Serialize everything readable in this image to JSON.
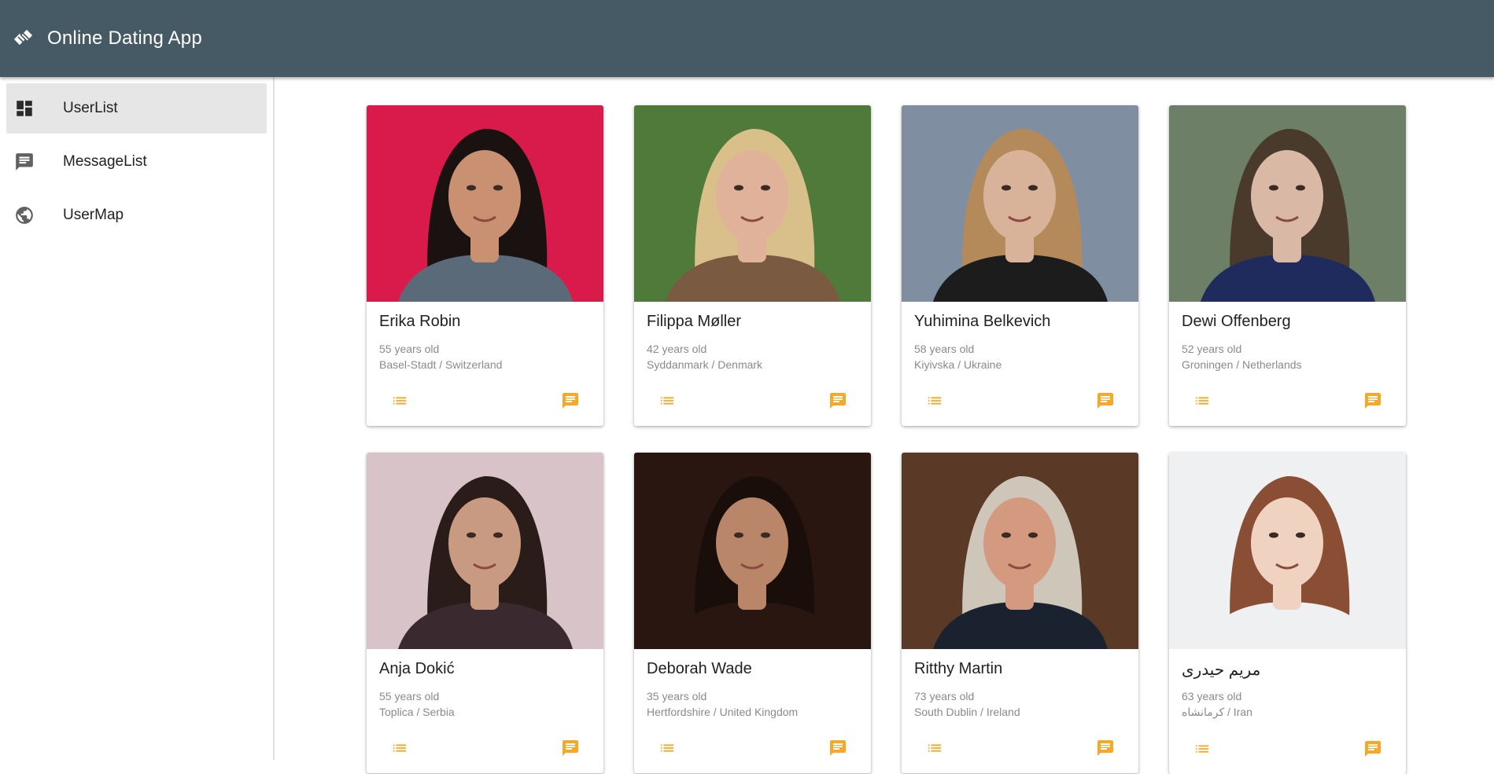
{
  "app": {
    "title": "Online Dating App",
    "logo_icon": "handshake-icon",
    "header_color": "#455a64"
  },
  "sidebar": {
    "items": [
      {
        "label": "UserList",
        "icon": "dashboard-icon",
        "active": true
      },
      {
        "label": "MessageList",
        "icon": "message-icon",
        "active": false
      },
      {
        "label": "UserMap",
        "icon": "globe-icon",
        "active": false
      }
    ]
  },
  "accent_color": "#f9a825",
  "users": [
    {
      "name": "Erika Robin",
      "age": "55 years old",
      "location": "Basel-Stadt / Switzerland",
      "photo_bg": "#d81b4a",
      "hair": "#1a1210",
      "skin": "#c99072",
      "shirt": "#5b6a78"
    },
    {
      "name": "Filippa Møller",
      "age": "42 years old",
      "location": "Syddanmark / Denmark",
      "photo_bg": "#4f7a3a",
      "hair": "#d9c08a",
      "skin": "#e0b29a",
      "shirt": "#7a5a40"
    },
    {
      "name": "Yuhimina Belkevich",
      "age": "58 years old",
      "location": "Kiyivska / Ukraine",
      "photo_bg": "#7f8ea0",
      "hair": "#b48a5a",
      "skin": "#d8b299",
      "shirt": "#1c1c1c"
    },
    {
      "name": "Dewi Offenberg",
      "age": "52 years old",
      "location": "Groningen / Netherlands",
      "photo_bg": "#6d7f66",
      "hair": "#4a3a2c",
      "skin": "#d9b9a6",
      "shirt": "#1f2b5c"
    },
    {
      "name": "Anja Dokić",
      "age": "55 years old",
      "location": "Toplica / Serbia",
      "photo_bg": "#d8c4c8",
      "hair": "#2a1c18",
      "skin": "#c99a82",
      "shirt": "#3a2a30"
    },
    {
      "name": "Deborah Wade",
      "age": "35 years old",
      "location": "Hertfordshire / United Kingdom",
      "photo_bg": "#2a1610",
      "hair": "#1a0e0a",
      "skin": "#b9866a",
      "shirt": "#2a1610"
    },
    {
      "name": "Ritthy Martin",
      "age": "73 years old",
      "location": "South Dublin / Ireland",
      "photo_bg": "#5a3a26",
      "hair": "#cfc6ba",
      "skin": "#d39a80",
      "shirt": "#1a2230"
    },
    {
      "name": "مریم حیدری",
      "age": "63 years old",
      "location": "کرمانشاه / Iran",
      "photo_bg": "#eef0f2",
      "hair": "#8a4e34",
      "skin": "#f0d2c0",
      "shirt": "#eef0f2"
    }
  ],
  "card_actions": {
    "details_icon": "list-icon",
    "message_icon": "chat-icon"
  }
}
